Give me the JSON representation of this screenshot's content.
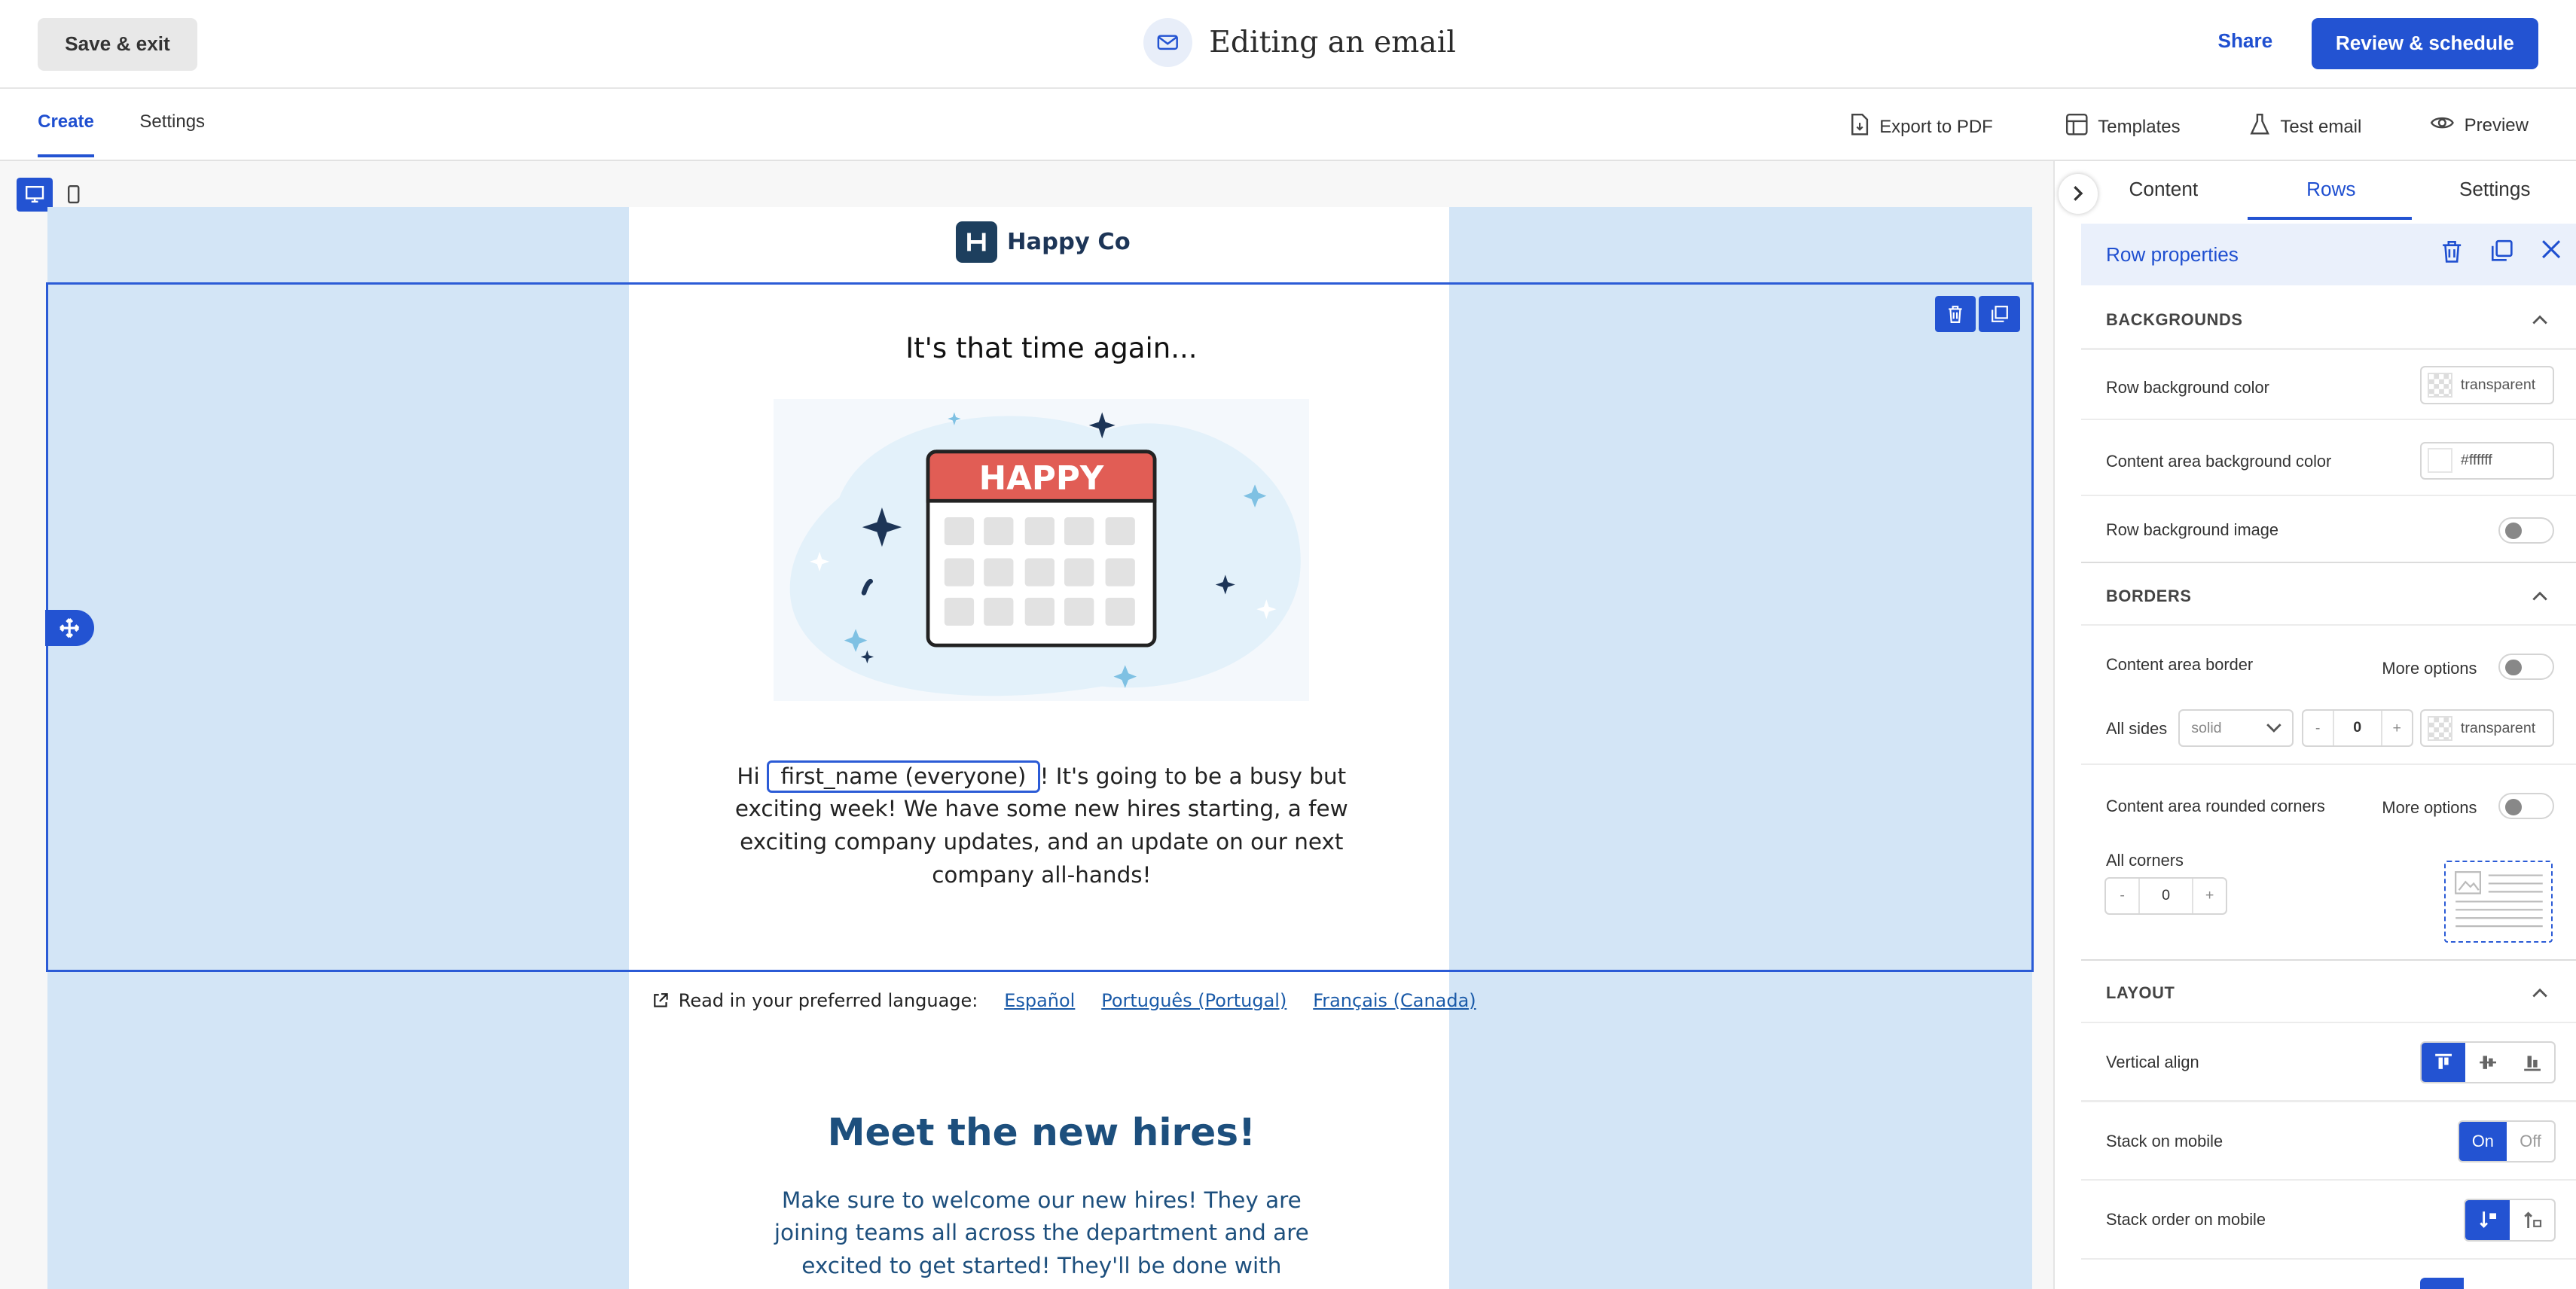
{
  "topbar": {
    "exit_label": "Save & exit",
    "title": "Editing an email",
    "share_label": "Share",
    "review_label": "Review & schedule"
  },
  "subbar": {
    "tabs": [
      "Create",
      "Settings"
    ],
    "tools": [
      {
        "label": "Export to PDF",
        "icon": "pdf-export-icon"
      },
      {
        "label": "Templates",
        "icon": "templates-icon"
      },
      {
        "label": "Test email",
        "icon": "flask-icon"
      },
      {
        "label": "Preview",
        "icon": "eye-icon"
      }
    ]
  },
  "email": {
    "brand": "Happy Co",
    "headline": "It's that time again...",
    "illustration_text": "HAPPY",
    "greeting": "Hi",
    "merge_tag": "first_name (everyone)",
    "body_rest": "! It's going to be a busy but exciting week! We have some new hires starting, a few exciting company updates, and an update on our next company all-hands!",
    "lang_prompt": "Read in your preferred language:",
    "languages": [
      "Español",
      "Português (Portugal)",
      "Français (Canada)"
    ],
    "section_title": "Meet the new hires!",
    "section_body": "Make sure to welcome our new hires! They are joining teams all across the department and are excited to get started! They'll be done with"
  },
  "panel": {
    "tabs": [
      "Content",
      "Rows",
      "Settings"
    ],
    "active_tab": "Rows",
    "header": "Row properties",
    "backgrounds": {
      "title": "BACKGROUNDS",
      "row_bg_label": "Row background color",
      "row_bg_value": "transparent",
      "content_bg_label": "Content area background color",
      "content_bg_value": "#ffffff",
      "row_bg_image_label": "Row background image"
    },
    "borders": {
      "title": "BORDERS",
      "content_border_label": "Content area border",
      "more_options": "More options",
      "all_sides_label": "All sides",
      "style_value": "solid",
      "minus": "-",
      "width_value": "0",
      "plus": "+",
      "color_value": "transparent",
      "rounded_label": "Content area rounded corners",
      "all_corners_label": "All corners",
      "corner_value": "0"
    },
    "layout": {
      "title": "LAYOUT",
      "valign_label": "Vertical align",
      "stack_label": "Stack on mobile",
      "on": "On",
      "off": "Off",
      "stack_order_label": "Stack order on mobile"
    }
  },
  "colors": {
    "accent": "#2353d2",
    "row_bg": "#d3e5f6",
    "heading_blue": "#1d4f7d"
  }
}
